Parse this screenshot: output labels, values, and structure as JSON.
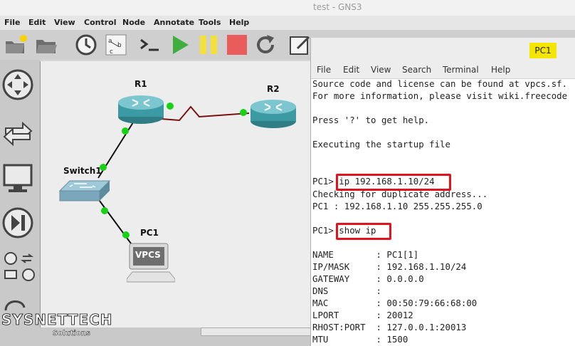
{
  "window": {
    "title": "test - GNS3"
  },
  "menubar": {
    "items": [
      "File",
      "Edit",
      "View",
      "Control",
      "Node",
      "Annotate",
      "Tools",
      "Help"
    ]
  },
  "topology": {
    "nodes": [
      {
        "label": "R1"
      },
      {
        "label": "R2"
      },
      {
        "label": "Switch1"
      },
      {
        "label": "PC1",
        "device_text": "VPCS"
      }
    ]
  },
  "terminal": {
    "badge": "PC1",
    "menu": [
      "File",
      "Edit",
      "View",
      "Search",
      "Terminal",
      "Help"
    ],
    "lines": [
      "Source code and license can be found at vpcs.sf.",
      "For more information, please visit wiki.freecode",
      "",
      "Press '?' to get help.",
      "",
      "Executing the startup file",
      "",
      "",
      "PC1> ip 192.168.1.10/24",
      "Checking for duplicate address...",
      "PC1 : 192.168.1.10 255.255.255.0",
      "",
      "PC1> show ip",
      "",
      "NAME        : PC1[1]",
      "IP/MASK     : 192.168.1.10/24",
      "GATEWAY     : 0.0.0.0",
      "DNS         :",
      "MAC         : 00:50:79:66:68:00",
      "LPORT       : 20012",
      "RHOST:PORT  : 127.0.0.1:20013",
      "MTU         : 1500"
    ]
  },
  "watermark": {
    "brand": "SYSNETTECH",
    "sub": "Solutions"
  }
}
